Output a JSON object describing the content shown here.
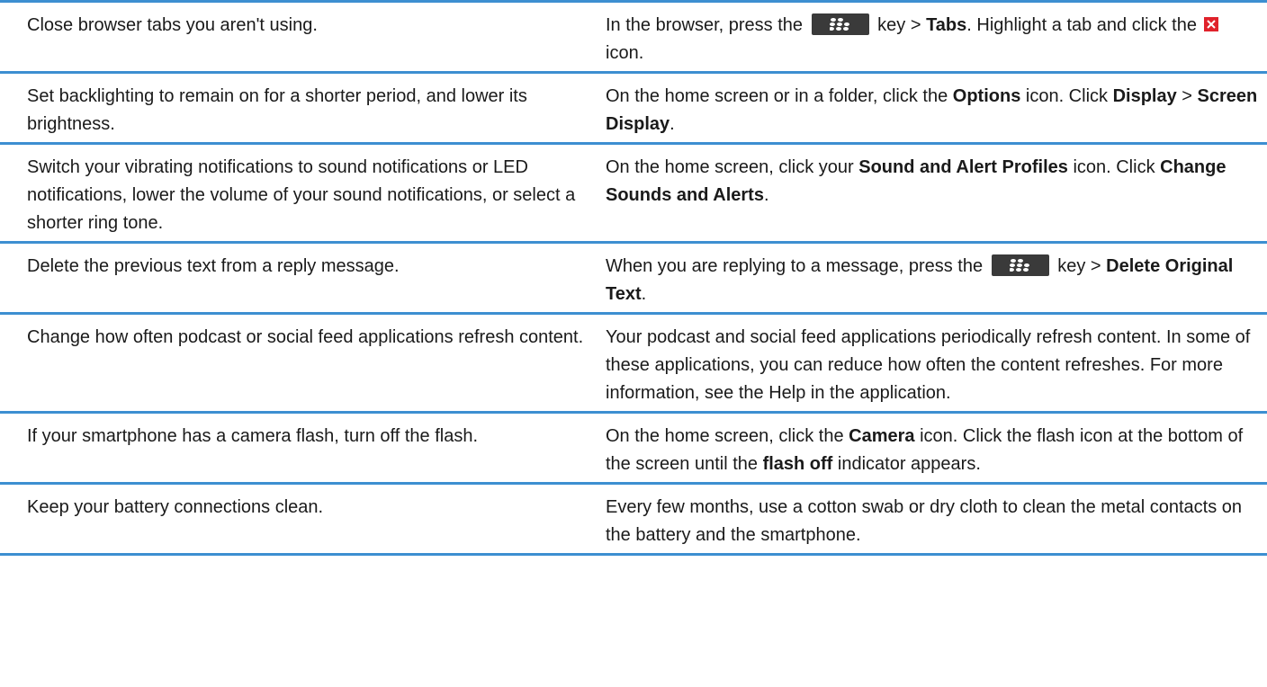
{
  "rows": [
    {
      "tip": "Close browser tabs you aren't using.",
      "how": {
        "t1": "In the browser, press the",
        "t2": "key >",
        "b1": "Tabs",
        "t3": ". Highlight a tab and click the",
        "t4": "icon."
      }
    },
    {
      "tip": "Set backlighting to remain on for a shorter period, and lower its brightness.",
      "how": {
        "t1": "On the home screen or in a folder, click the",
        "b1": "Options",
        "t2": "icon. Click",
        "b2": "Display",
        "t3": ">",
        "b3": "Screen Display",
        "t4": "."
      }
    },
    {
      "tip": "Switch your vibrating notifications to sound notifications or LED notifications, lower the volume of your sound notifications, or select a shorter ring tone.",
      "how": {
        "t1": "On the home screen, click your",
        "b1": "Sound and Alert Profiles",
        "t2": "icon. Click",
        "b2": "Change Sounds and Alerts",
        "t3": "."
      }
    },
    {
      "tip": "Delete the previous text from a reply message.",
      "how": {
        "t1": "When you are replying to a message, press the",
        "t2": "key >",
        "b1": "Delete Original Text",
        "t3": "."
      }
    },
    {
      "tip": "Change how often podcast or social feed applications refresh content.",
      "how": {
        "t1": "Your podcast and social feed applications periodically refresh content. In some of these applications, you can reduce how often the content refreshes. For more information, see the Help in the application."
      }
    },
    {
      "tip": "If your smartphone has a camera flash, turn off the flash.",
      "how": {
        "t1": "On the home screen, click the",
        "b1": "Camera",
        "t2": "icon. Click the flash icon at the bottom of the screen until the",
        "b2": "flash off",
        "t3": "indicator appears."
      }
    },
    {
      "tip": "Keep your battery connections clean.",
      "how": {
        "t1": "Every few months, use a cotton swab or dry cloth to clean the metal contacts on the battery and the smartphone."
      }
    }
  ],
  "icons": {
    "menu_key": "blackberry-menu-key-icon",
    "close": "close-icon"
  },
  "colors": {
    "rule": "#3d8fd1",
    "menu_key_bg": "#3a3a3a",
    "close_bg": "#e0222b"
  }
}
